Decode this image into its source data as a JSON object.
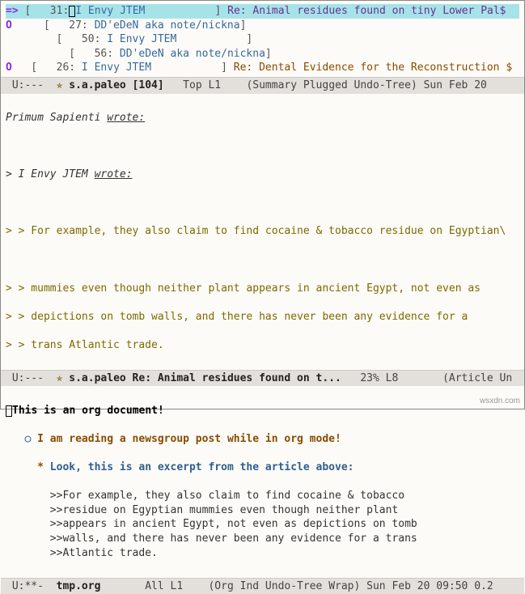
{
  "summary": {
    "lines": [
      {
        "arrow": "=>",
        "open": "[   31:",
        "author": "I Envy JTEM           ",
        "close": "]",
        "subject": " Re: Animal residues found on tiny Lower Pal$",
        "sel": true,
        "cls": "subject-re"
      },
      {
        "arrow": "O ",
        "open": "   [   27:",
        "author": " DD'eDeN aka note/nickna",
        "close": "]",
        "subject": "",
        "sel": false,
        "cls": ""
      },
      {
        "arrow": "  ",
        "open": "     [   50:",
        "author": " I Envy JTEM           ",
        "close": "]",
        "subject": "",
        "sel": false,
        "cls": ""
      },
      {
        "arrow": "  ",
        "open": "       [   56:",
        "author": " DD'eDeN aka note/nickna",
        "close": "]",
        "subject": "",
        "sel": false,
        "cls": ""
      },
      {
        "arrow": "O ",
        "open": " [   26:",
        "author": " I Envy JTEM           ",
        "close": "]",
        "subject": " Re: Dental Evidence for the Reconstruction $",
        "sel": false,
        "cls": "subject-dental"
      }
    ]
  },
  "modeline1": {
    "status": " U:---  ",
    "icon": "✯",
    "buf": " s.a.paleo [104]   ",
    "pos": "Top L1    ",
    "modes": "(Summary Plugged Undo-Tree) Sun Feb 20"
  },
  "article": {
    "top_author": "Primum Sapienti ",
    "wrote": "wrote:",
    "inner_pref": "> ",
    "inner_author": "I Envy JTEM ",
    "inner_wrote": "wrote:",
    "l1": "> > For example, they also claim to find cocaine & tobacco residue on Egyptian\\",
    "l2": "> > mummies even though neither plant appears in ancient Egypt, not even as",
    "l3": "> > depictions on tomb walls, and there has never been any evidence for a",
    "l4": "> > trans Atlantic trade."
  },
  "modeline2": {
    "status": " U:---  ",
    "icon": "✯",
    "buf": " s.a.paleo Re: Animal residues found on t...   ",
    "pos": "23% L8       ",
    "modes": "(Article Un"
  },
  "org": {
    "h1_bullet": "◉ ",
    "h1": "This is an org document!",
    "h2_bullet": "   ○ ",
    "h2": "I am reading a newsgroup post while in org mode!",
    "h3_bullet": "     * ",
    "h3": "Look, this is an excerpt from the article above:",
    "body": [
      "       >>For example, they also claim to find cocaine & tobacco",
      "       >>residue on Egyptian mummies even though neither plant",
      "       >>appears in ancient Egypt, not even as depictions on tomb",
      "       >>walls, and there has never been any evidence for a trans",
      "       >>Atlantic trade."
    ]
  },
  "modeline3": {
    "status": " U:**-  ",
    "buf": "tmp.org       ",
    "pos": "All L1    ",
    "modes": "(Org Ind Undo-Tree Wrap) Sun Feb 20 09:50 0.2"
  },
  "watermark": "wsxdn.com"
}
